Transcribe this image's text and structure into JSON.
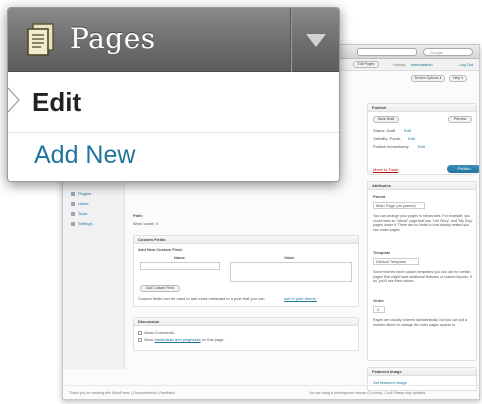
{
  "menu": {
    "title": "Pages",
    "icon": "pages-icon",
    "toggle_icon": "chevron-down-icon",
    "items": [
      {
        "label": "Edit",
        "current": true
      },
      {
        "label": "Add New",
        "current": false
      }
    ],
    "colors": {
      "header": "#6e6e6e",
      "link": "#21759b",
      "current_text": "#222222"
    }
  },
  "background": {
    "search_placeholder": "Google",
    "admin_bar": {
      "edit_pages": "Edit Pages",
      "howdy_prefix": "Howdy,",
      "user": "wemoadmin",
      "logout": "Log Out",
      "screen_options": "Screen Options ▾",
      "help": "Help ▾"
    },
    "sidebar": [
      "Plugins",
      "Users",
      "Tools",
      "Settings"
    ],
    "publish": {
      "title": "Publish",
      "save_draft": "Save Draft",
      "preview": "Preview",
      "status": "Status: Draft",
      "visibility": "Visibility: Public",
      "publish_immediately": "Publish immediately",
      "edit": "Edit",
      "move_to_trash": "Move to Trash",
      "publish_button": "Publish"
    },
    "path": {
      "label": "Path:",
      "word_count": "Word count: 0"
    },
    "attributes": {
      "title": "Attributes",
      "parent_label": "Parent",
      "parent_value": "Main Page (no parent)",
      "parent_help": "You can arrange your pages in hierarchies. For example, you could have an \"About\" page that has \"Life Story\" and \"My Dog\" pages under it. There are no limits to how deeply nested you can make pages.",
      "template_label": "Template",
      "template_value": "Default Template",
      "template_help": "Some themes have custom templates you can use for certain pages that might have additional features or custom layouts. If so, you'll see them above.",
      "order_label": "Order",
      "order_value": "0",
      "order_help": "Pages are usually ordered alphabetically, but you can put a number above to change the order pages appear in."
    },
    "featured_image": {
      "title": "Featured Image",
      "link": "Set featured image"
    },
    "custom_fields": {
      "title": "Custom Fields",
      "add_new": "Add New Custom Field:",
      "name_col": "Name",
      "value_col": "Value",
      "add_button": "Add Custom Field",
      "help": "Custom fields can be used to add extra metadata to a post that you can",
      "help_link": "use in your theme."
    },
    "discussion": {
      "title": "Discussion",
      "allow_comments": "Allow Comments.",
      "allow_trackbacks_prefix": "Allow",
      "allow_trackbacks_link": "trackbacks and pingbacks",
      "allow_trackbacks_suffix": "on this page."
    },
    "footer": {
      "left": "Thank you for creating with WordPress. | Documentation | Feedback",
      "right": "You are using a development version (3.x-beta). Cool! Please stay updated."
    }
  }
}
